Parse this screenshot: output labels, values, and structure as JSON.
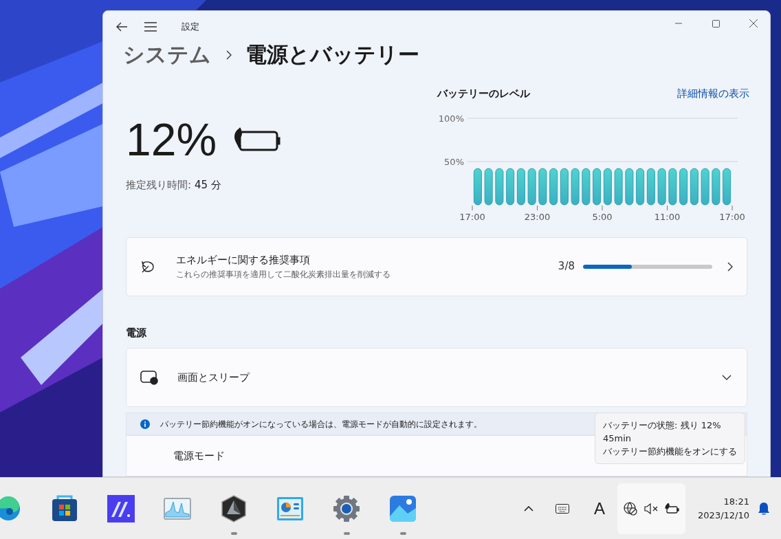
{
  "window": {
    "title": "設定"
  },
  "breadcrumb": {
    "parent": "システム",
    "current": "電源とバッテリー"
  },
  "battery": {
    "percent": "12%",
    "remaining_label": "推定残り時間:",
    "remaining_value": "45 分",
    "saver_on": true
  },
  "battery_level": {
    "title": "バッテリーのレベル",
    "link": "詳細情報の表示",
    "axis_end_label": "17:00",
    "chart_data": {
      "type": "bar",
      "categories": [
        "17:00",
        null,
        null,
        null,
        null,
        null,
        "23:00",
        null,
        null,
        null,
        null,
        null,
        "5:00",
        null,
        null,
        null,
        null,
        null,
        "11:00",
        null,
        null,
        null,
        null,
        null
      ],
      "values": [
        42,
        42,
        42,
        42,
        42,
        42,
        42,
        42,
        42,
        42,
        42,
        42,
        42,
        42,
        42,
        42,
        42,
        42,
        42,
        42,
        42,
        42,
        42,
        42
      ],
      "ylim": [
        0,
        100
      ],
      "yticks": [
        {
          "value": 50,
          "label": "50%"
        },
        {
          "value": 100,
          "label": "100%"
        }
      ]
    }
  },
  "recommendations": {
    "title": "エネルギーに関する推奨事項",
    "subtitle": "これらの推奨事項を適用して二酸化炭素排出量を削減する",
    "count": "3/8",
    "level": 0.375
  },
  "power_section": {
    "heading": "電源",
    "screen_sleep": {
      "label": "画面とスリープ",
      "expanded": false
    },
    "info": "バッテリー節約機能がオンになっている場合は、電源モードが自動的に設定されます。",
    "power_mode": {
      "label": "電源モード"
    }
  },
  "tooltip": {
    "lines": [
      "バッテリーの状態: 残り 12%",
      "45min",
      "バッテリー節約機能をオンにする"
    ]
  },
  "taskbar": {
    "apps": [
      {
        "kind": "edge",
        "running": false
      },
      {
        "kind": "store",
        "running": false
      },
      {
        "kind": "ai",
        "running": false
      },
      {
        "kind": "monitor",
        "running": false
      },
      {
        "kind": "hex",
        "running": true
      },
      {
        "kind": "panel",
        "running": false
      },
      {
        "kind": "gear",
        "running": true
      },
      {
        "kind": "photos",
        "running": true
      }
    ],
    "ime": "A",
    "time": "18:21",
    "date": "2023/12/10",
    "muted": true
  }
}
